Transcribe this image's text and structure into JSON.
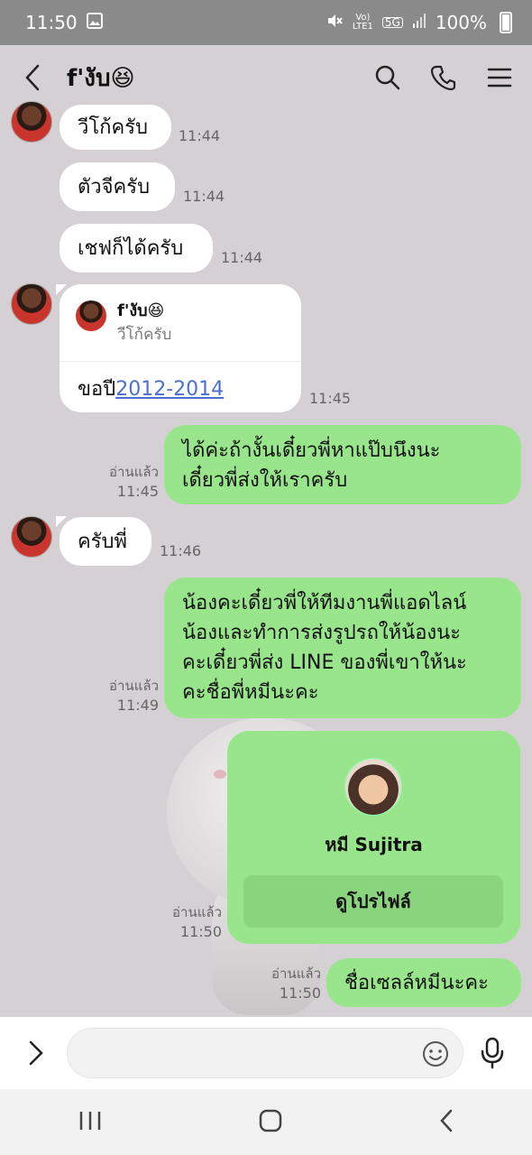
{
  "status_bar": {
    "time": "11:50",
    "volte_label": "Vo)\nLTE1",
    "network_label": "5G",
    "battery": "100%"
  },
  "header": {
    "title": "f'งับ😆"
  },
  "messages": {
    "m1": {
      "text": "วีโก้ครับ",
      "time": "11:44"
    },
    "m2": {
      "text": "ตัวจีครับ",
      "time": "11:44"
    },
    "m3": {
      "text": "เชฟก็ได้ครับ",
      "time": "11:44"
    },
    "reply": {
      "quoted_name": "f'งับ😆",
      "quoted_text": "วีโก้ครับ",
      "body_prefix": "ขอปี",
      "body_link": "2012-2014",
      "time": "11:45"
    },
    "m5": {
      "line1": "ได้ค่ะถ้างั้นเดี๋ยวพี่หาแป๊บนึงนะ",
      "line2": "เดี๋ยวพี่ส่งให้เราครับ",
      "read": "อ่านแล้ว",
      "time": "11:45"
    },
    "m6": {
      "text": "ครับพี่",
      "time": "11:46"
    },
    "m7": {
      "line1": "น้องคะเดี๋ยวพี่ให้ทีมงานพี่แอดไลน์",
      "line2": "น้องและทำการส่งรูปรถให้น้องนะ",
      "line3": "คะเดี๋ยวพี่ส่ง LINE ของพี่เขาให้นะ",
      "line4": "คะชื่อพี่หมีนะคะ",
      "read": "อ่านแล้ว",
      "time": "11:49"
    },
    "contact": {
      "name": "หมี Sujitra",
      "button": "ดูโปรไฟล์",
      "read": "อ่านแล้ว",
      "time": "11:50"
    },
    "m9": {
      "text": "ชื่อเซลล์หมีนะคะ",
      "read": "อ่านแล้ว",
      "time": "11:50"
    }
  },
  "input": {
    "placeholder": ""
  },
  "colors": {
    "outgoing": "#99e58b",
    "incoming": "#ffffff",
    "link": "#4a6fd3"
  }
}
